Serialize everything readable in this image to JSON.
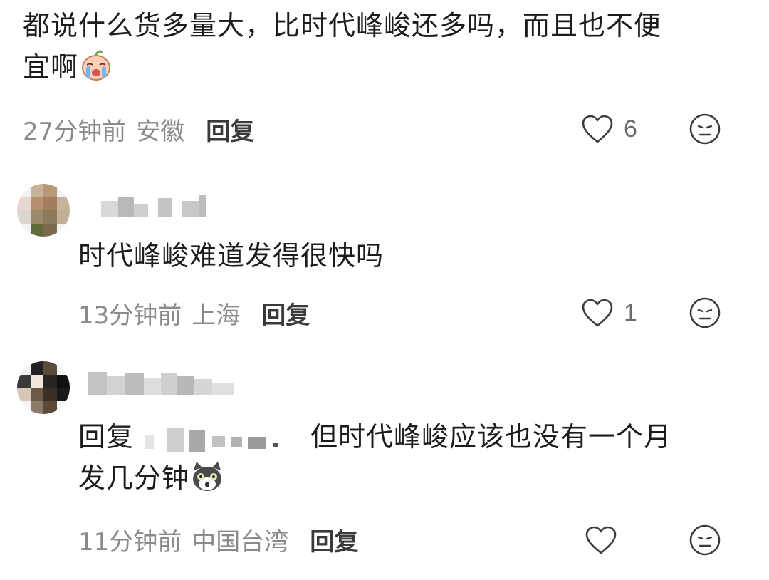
{
  "comments": [
    {
      "text_line1": "都说什么货多量大，比时代峰峻还多吗，而且也不便",
      "text_line2": "宜啊",
      "emoji": "crying-peach-icon",
      "time": "27分钟前",
      "location": "安徽",
      "reply_label": "回复",
      "like_count": "6"
    },
    {
      "text": "时代峰峻难道发得很快吗",
      "time": "13分钟前",
      "location": "上海",
      "reply_label": "回复",
      "like_count": "1"
    },
    {
      "reply_prefix": "回复",
      "text_line1": "但时代峰峻应该也没有一个月",
      "text_line2": "发几分钟",
      "emoji": "shocked-cat-icon",
      "time": "11分钟前",
      "location": "中国台湾",
      "reply_label": "回复",
      "like_count": ""
    }
  ],
  "colors": {
    "meta_text": "#8a8a8a",
    "body_text": "#1c1c1c",
    "reply_text": "#3a3a3a",
    "icon_stroke": "#3c3c3c"
  }
}
